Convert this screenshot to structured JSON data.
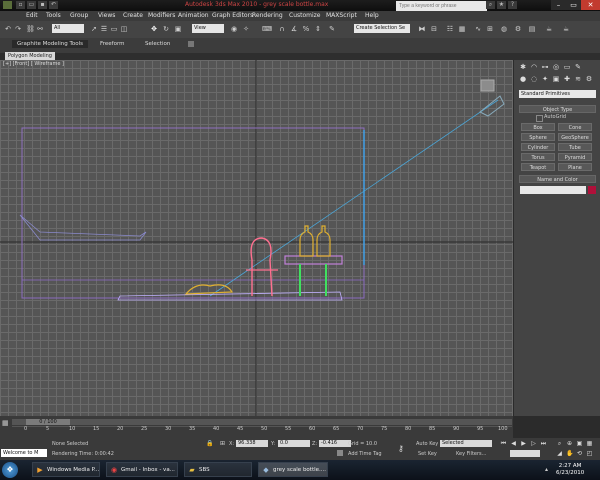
{
  "window": {
    "title": "Autodesk 3ds Max 2010  -  grey scale bottle.max",
    "search_placeholder": "Type a keyword or phrase"
  },
  "menu": [
    "Edit",
    "Tools",
    "Group",
    "Views",
    "Create",
    "Modifiers",
    "Animation",
    "Graph Editors",
    "Rendering",
    "Customize",
    "MAXScript",
    "Help"
  ],
  "toolbar": {
    "selection_filter": "All",
    "ref_coord": "View",
    "named_set": "Create Selection Se"
  },
  "ribbon": {
    "tabs": [
      "Graphite Modeling Tools",
      "Freeform",
      "Selection"
    ],
    "active_tab": "Graphite Modeling Tools",
    "panel_label": "Polygon Modeling"
  },
  "viewport": {
    "label": "[+] [Front] [ Wireframe ]"
  },
  "command_panel": {
    "category": "Standard Primitives",
    "object_type_header": "Object Type",
    "autogrid_label": "AutoGrid",
    "primitives": [
      "Box",
      "Cone",
      "Sphere",
      "GeoSphere",
      "Cylinder",
      "Tube",
      "Torus",
      "Pyramid",
      "Teapot",
      "Plane"
    ],
    "name_color_header": "Name and Color",
    "swatch_color": "#b0103a"
  },
  "timeline": {
    "frame_range": "0 / 100",
    "ticks": [
      "0",
      "5",
      "10",
      "15",
      "20",
      "25",
      "30",
      "35",
      "40",
      "45",
      "50",
      "55",
      "60",
      "65",
      "70",
      "75",
      "80",
      "85",
      "90",
      "95",
      "100"
    ]
  },
  "status": {
    "selection": "None Selected",
    "rendering_time": "Rendering Time: 0:00:42",
    "x_label": "X:",
    "x_value": "96.338",
    "y_label": "Y:",
    "y_value": "0.0",
    "z_label": "Z:",
    "z_value": "-0.416",
    "grid": "Grid = 10.0",
    "add_time_tag": "Add Time Tag",
    "auto_key": "Auto Key",
    "set_key": "Set Key",
    "key_mode": "Selected",
    "key_filters": "Key Filters..."
  },
  "maxscript_listener": "Welcome to M",
  "taskbar": {
    "items": [
      "Windows Media P...",
      "Gmail - Inbox - va...",
      "SBS",
      "grey scale bottle...."
    ],
    "time": "2:27 AM",
    "date": "6/23/2010"
  }
}
